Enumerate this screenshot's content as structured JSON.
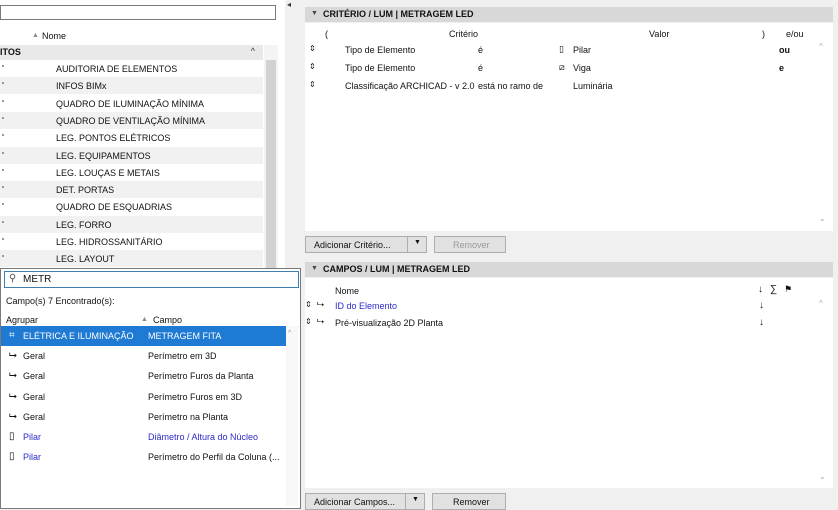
{
  "left_list": {
    "header": "Nome",
    "group": "ITOS",
    "items": [
      "AUDITORIA DE ELEMENTOS",
      "INFOS BIMx",
      "QUADRO DE ILUMINAÇÃO MÍNIMA",
      "QUADRO DE VENTILAÇÃO MÍNIMA",
      "LEG. PONTOS ELÉTRICOS",
      "LEG. EQUIPAMENTOS",
      "LEG. LOUÇAS E METAIS",
      "DET. PORTAS",
      "QUADRO DE ESQUADRIAS",
      "LEG. FORRO",
      "LEG. HIDROSSANITÁRIO",
      "LEG. LAYOUT"
    ]
  },
  "criteria": {
    "header": "CRITÉRIO / LUM | METRAGEM LED",
    "columns": {
      "open_paren": "(",
      "criterion": "Critério",
      "value": "Valor",
      "close_paren": ")",
      "logic": "e/ou"
    },
    "rows": [
      {
        "name": "Tipo de Elemento",
        "operator": "é",
        "icon": "column-icon",
        "value": "Pilar",
        "logic": "ou"
      },
      {
        "name": "Tipo de Elemento",
        "operator": "é",
        "icon": "beam-icon",
        "value": "Viga",
        "logic": "e"
      },
      {
        "name": "Classificação ARCHICAD - v 2.0",
        "operator": "está no ramo de",
        "icon": "",
        "value": "Luminária",
        "logic": ""
      }
    ],
    "add_button": "Adicionar Critério...",
    "remove_button": "Remover"
  },
  "fields": {
    "header": "CAMPOS / LUM | METRAGEM LED",
    "col_name": "Nome",
    "col_sort": "↓",
    "col_sum": "∑",
    "rows": [
      {
        "label": "ID do Elemento",
        "color": "#2b2bc8",
        "sort": "↓"
      },
      {
        "label": "Pré-visualização 2D Planta",
        "color": "#111111",
        "sort": "↓"
      }
    ],
    "add_button": "Adicionar Campos...",
    "remove_button": "Remover"
  },
  "popup": {
    "search_value": "METR",
    "found_text": "Campo(s) 7 Encontrado(s):",
    "col_group": "Agrupar",
    "col_field": "Campo",
    "rows": [
      {
        "icon": "lamp-icon",
        "group": "ELÉTRICA E ILUMINAÇÃO",
        "field": "METRAGEM FITA",
        "selected": true
      },
      {
        "icon": "pointer-icon",
        "group": "Geral",
        "field": "Perímetro em 3D"
      },
      {
        "icon": "pointer-icon",
        "group": "Geral",
        "field": "Perímetro Furos da Planta"
      },
      {
        "icon": "pointer-icon",
        "group": "Geral",
        "field": "Perímetro Furos em 3D"
      },
      {
        "icon": "pointer-icon",
        "group": "Geral",
        "field": "Perímetro na Planta"
      },
      {
        "icon": "column-icon",
        "group": "Pilar",
        "field": "Diâmetro / Altura do Núcleo",
        "blue": true
      },
      {
        "icon": "column-icon",
        "group": "Pilar",
        "field": "Perímetro do Perfil da Coluna (..."
      }
    ]
  }
}
